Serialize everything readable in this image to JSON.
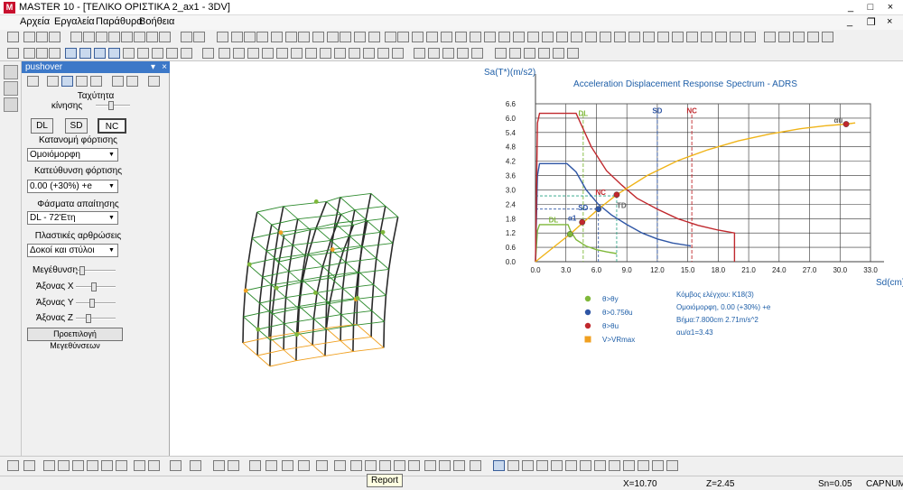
{
  "window": {
    "title": "MASTER 10 - [ΤΕΛΙΚΟ ΟΡΙΣΤΙΚΑ 2_ax1 - 3DV]",
    "app_icon_text": "M",
    "minimize": "_",
    "maximize": "□",
    "close": "×",
    "mdi_minimize": "_",
    "mdi_restore": "❐",
    "mdi_close": "×"
  },
  "menu": [
    "Αρχεία",
    "Εργαλεία",
    "Παράθυρα",
    "Βοήθεια"
  ],
  "panel": {
    "title": "pushover",
    "pin": "▾",
    "close": "×",
    "speed_label": "Ταχύτητα",
    "speed_label2": "κίνησης",
    "speed_value": 0.45,
    "perf_buttons": [
      "DL",
      "SD",
      "NC"
    ],
    "perf_selected": "NC",
    "load_dist_label": "Κατανομή φόρτισης",
    "load_dist_value": "Ομοιόμορφη",
    "load_dir_label": "Κατεύθυνση φόρτισης",
    "load_dir_value": "0.00 (+30%) +e",
    "spectra_label": "Φάσματα απαίτησης",
    "spectra_value": "DL - 72'Ετη",
    "hinges_label": "Πλαστικές αρθρώσεις",
    "hinges_value": "Δοκοί και στύλοι",
    "magnify_label": "Μεγέθυνση",
    "magnify_value": 0.1,
    "axis_x_label": "Άξονας X",
    "axis_x_value": 0.45,
    "axis_y_label": "Άξονας Y",
    "axis_y_value": 0.4,
    "axis_z_label": "Άξονας Z",
    "axis_z_value": 0.3,
    "default_btn": "Προεπιλογή Μεγεθύνσεων"
  },
  "colors": {
    "plot_frame": "#606060",
    "title_blue": "#1f5fa8",
    "green_line": "#7fb83a",
    "blue_line": "#2f56a5",
    "red_line": "#c0282d",
    "capacity": "#f0b418",
    "orange": "#f0a020",
    "column": "#2a2a2a",
    "beam_green": "#2e8b2e"
  },
  "chart_data": {
    "type": "line",
    "title": "Acceleration Displacement Response Spectrum - ADRS",
    "ylabel": "Sa(T*)(m/s2)",
    "xlabel": "Sd(cm)",
    "xlim": [
      0,
      33
    ],
    "ylim": [
      0,
      6.6
    ],
    "xticks": [
      "0.0",
      "3.0",
      "6.0",
      "9.0",
      "12.0",
      "15.0",
      "18.0",
      "21.0",
      "24.0",
      "27.0",
      "30.0",
      "33.0"
    ],
    "yticks": [
      "0.0",
      "0.6",
      "1.2",
      "1.8",
      "2.4",
      "3.0",
      "3.6",
      "4.2",
      "4.8",
      "5.4",
      "6.0",
      "6.6"
    ],
    "grid": true,
    "performance_levels": [
      {
        "label": "DL",
        "sd": 4.7,
        "label_y": 6.1
      },
      {
        "label": "SD",
        "sd": 12.0,
        "label_y": 6.2
      },
      {
        "label": "NC",
        "sd": 15.4,
        "label_y": 6.2
      }
    ],
    "annotations": [
      {
        "text": "DL",
        "x": 1.3,
        "y": 1.65,
        "color": "#7fb83a"
      },
      {
        "text": "α1",
        "x": 3.2,
        "y": 1.72,
        "color": "#2f56a5"
      },
      {
        "text": "SD",
        "x": 4.2,
        "y": 2.15,
        "color": "#2f56a5"
      },
      {
        "text": "NC",
        "x": 5.9,
        "y": 2.8,
        "color": "#c0282d"
      },
      {
        "text": "TD",
        "x": 8.0,
        "y": 2.25,
        "color": "#606060"
      },
      {
        "text": "αu",
        "x": 29.4,
        "y": 5.8,
        "color": "#606060"
      }
    ],
    "markers": [
      {
        "x": 3.4,
        "y": 1.15,
        "color": "#7fb83a"
      },
      {
        "x": 4.6,
        "y": 1.65,
        "color": "#c0282d"
      },
      {
        "x": 6.2,
        "y": 2.2,
        "color": "#2f56a5"
      },
      {
        "x": 8.0,
        "y": 2.8,
        "color": "#c0282d"
      },
      {
        "x": 30.6,
        "y": 5.75,
        "color": "#c0282d"
      }
    ],
    "series": [
      {
        "color": "#7fb83a",
        "x": [
          0.0,
          0.2,
          0.4,
          3.2,
          3.5,
          4.0,
          5.0,
          6.0,
          7.0,
          8.0
        ],
        "y": [
          0.0,
          1.3,
          1.55,
          1.55,
          1.25,
          0.92,
          0.65,
          0.5,
          0.41,
          0.34
        ]
      },
      {
        "color": "#2f56a5",
        "x": [
          0.0,
          0.2,
          0.4,
          3.1,
          4.0,
          5.0,
          6.2,
          7.5,
          9.0,
          10.5,
          12.0,
          13.5,
          15.3
        ],
        "y": [
          0.0,
          3.6,
          4.1,
          4.1,
          3.75,
          3.0,
          2.4,
          1.95,
          1.55,
          1.2,
          0.95,
          0.78,
          0.66
        ]
      },
      {
        "color": "#c0282d",
        "x": [
          0.0,
          0.2,
          0.4,
          4.0,
          5.5,
          7.0,
          8.5,
          10.0,
          12.0,
          14.0,
          16.0,
          18.0,
          19.6,
          19.6
        ],
        "y": [
          0.0,
          5.8,
          6.2,
          6.2,
          4.8,
          3.8,
          3.2,
          2.65,
          2.2,
          1.8,
          1.52,
          1.32,
          1.2,
          0.0
        ]
      },
      {
        "color": "#f0b418",
        "x": [
          0.0,
          3.4,
          6.2,
          8.0,
          11.0,
          14.0,
          17.0,
          20.0,
          23.0,
          26.0,
          28.5,
          30.6,
          31.5
        ],
        "y": [
          0.0,
          1.15,
          2.2,
          2.8,
          3.6,
          4.22,
          4.68,
          5.05,
          5.33,
          5.55,
          5.68,
          5.75,
          5.8
        ]
      }
    ],
    "dashed_lines": [
      {
        "color": "#2f56a5",
        "x": [
          0,
          6.2
        ],
        "y": [
          2.2,
          2.2
        ]
      },
      {
        "color": "#2f56a5",
        "x": [
          6.2,
          6.2
        ],
        "y": [
          0,
          2.2
        ]
      },
      {
        "color": "#20a080",
        "x": [
          0,
          8.0
        ],
        "y": [
          2.75,
          2.75
        ]
      },
      {
        "color": "#20a080",
        "x": [
          8.0,
          8.0
        ],
        "y": [
          0,
          2.8
        ]
      }
    ]
  },
  "legend": [
    {
      "color": "#7fb83a",
      "label": "θ>θy",
      "shape": "circle"
    },
    {
      "color": "#2f56a5",
      "label": "θ>0.75θu",
      "shape": "circle"
    },
    {
      "color": "#c0282d",
      "label": "θ>θu",
      "shape": "circle"
    },
    {
      "color": "#f0a020",
      "label": "V>VRmax",
      "shape": "square"
    }
  ],
  "info": [
    "Κόμβος ελέγχου: K18(3)",
    "Ομοιόμορφη, 0.00 (+30%) +e",
    "Βήμα:7.800cm 2.71m/s^2",
    "αu/α1=3.43"
  ],
  "tooltip": "Report",
  "status": {
    "x": "X=10.70",
    "z": "Z=2.45",
    "sn": "Sn=0.05",
    "caps": "CAP",
    "num": "NUM"
  }
}
